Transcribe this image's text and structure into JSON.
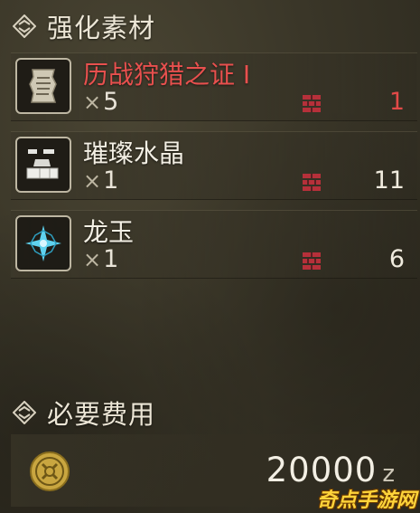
{
  "sections": {
    "materials_title": "强化素材",
    "cost_title": "必要费用"
  },
  "materials": [
    {
      "name": "历战狩猎之证 I",
      "required": "5",
      "owned": "1",
      "insufficient": true,
      "icon": "scroll-icon"
    },
    {
      "name": "璀璨水晶",
      "required": "1",
      "owned": "11",
      "insufficient": false,
      "icon": "crystal-icon"
    },
    {
      "name": "龙玉",
      "required": "1",
      "owned": "6",
      "insufficient": false,
      "icon": "dragon-jewel-icon"
    }
  ],
  "quantity_prefix": "×",
  "cost": {
    "amount": "20000",
    "currency_suffix": "z",
    "icon": "zenny-coin-icon"
  },
  "watermark": "奇点手游网",
  "colors": {
    "insufficient": "#e24a48",
    "text": "#f3efe4",
    "frame": "#bdb6a2",
    "box": "#b6303a"
  }
}
